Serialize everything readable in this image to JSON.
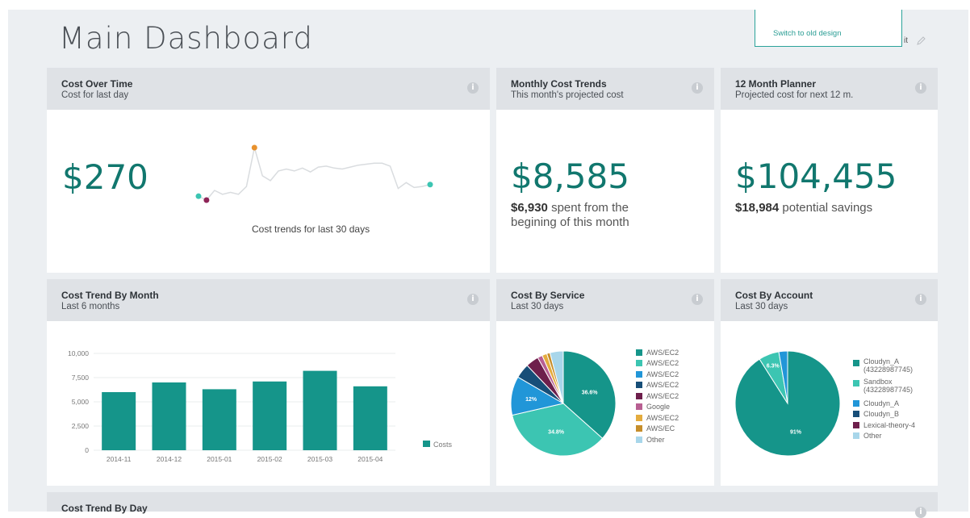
{
  "header": {
    "title": "Main Dashboard",
    "switch_link": "Switch to old design",
    "edit_fragment": "it"
  },
  "cards": {
    "cost_over_time": {
      "title": "Cost Over Time",
      "subtitle": "Cost for last day",
      "value": "$270",
      "caption": "Cost trends for last 30 days",
      "sparkline": [
        24,
        20,
        30,
        26,
        28,
        26,
        34,
        74,
        45,
        40,
        50,
        52,
        50,
        53,
        49,
        54,
        55,
        53,
        52,
        54,
        56,
        57,
        58,
        58,
        55,
        32,
        38,
        33,
        34,
        36
      ]
    },
    "monthly_cost_trends": {
      "title": "Monthly Cost Trends",
      "subtitle": "This month's projected cost",
      "value": "$8,585",
      "detail_amount": "$6,930",
      "detail_text_1": "spent from the",
      "detail_text_2": "begining of this month"
    },
    "planner": {
      "title": "12 Month Planner",
      "subtitle": "Projected cost for next 12 m.",
      "value": "$104,455",
      "detail_amount": "$18,984",
      "detail_text": "potential savings"
    },
    "cost_by_month": {
      "title": "Cost Trend By Month",
      "subtitle": "Last 6 months"
    },
    "cost_by_service": {
      "title": "Cost By Service",
      "subtitle": "Last 30 days",
      "legend": [
        {
          "label": "AWS/EC2",
          "color": "#15958a"
        },
        {
          "label": "AWS/EC2",
          "color": "#3cc5b2"
        },
        {
          "label": "AWS/EC2",
          "color": "#2196d8"
        },
        {
          "label": "AWS/EC2",
          "color": "#174e78"
        },
        {
          "label": "AWS/EC2",
          "color": "#6e1f4c"
        },
        {
          "label": "Google",
          "color": "#b85f92"
        },
        {
          "label": "AWS/EC2",
          "color": "#e4ac3e"
        },
        {
          "label": "AWS/EC",
          "color": "#c68e2b"
        },
        {
          "label": "Other",
          "color": "#a8d6ea"
        }
      ]
    },
    "cost_by_account": {
      "title": "Cost By Account",
      "subtitle": "Last 30 days",
      "legend": [
        {
          "label": "Cloudyn_A",
          "label2": "(43228987745)",
          "color": "#15958a"
        },
        {
          "label": "Sandbox",
          "label2": "(43228987745)",
          "color": "#3cc5b2"
        },
        {
          "label": "Cloudyn_A",
          "label2": "",
          "color": "#2196d8"
        },
        {
          "label": "Cloudyn_B",
          "label2": "",
          "color": "#174e78"
        },
        {
          "label": "Lexical-theory-4",
          "label2": "",
          "color": "#6e1f4c"
        },
        {
          "label": "Other",
          "label2": "",
          "color": "#a8d6ea"
        }
      ]
    },
    "cost_by_day": {
      "title": "Cost Trend By Day"
    }
  },
  "chart_data": [
    {
      "type": "bar",
      "categories": [
        "2014-11",
        "2014-12",
        "2015-01",
        "2015-02",
        "2015-03",
        "2015-04"
      ],
      "series": [
        {
          "name": "Costs",
          "values": [
            6000,
            7000,
            6300,
            7100,
            8200,
            6600
          ],
          "color": "#15958a"
        }
      ],
      "yticks": [
        "0",
        "2,500",
        "5,000",
        "7,500",
        "10,000"
      ],
      "ylim": [
        0,
        10000
      ],
      "legend_position": "right"
    },
    {
      "type": "pie",
      "slices": [
        {
          "value": 36.6,
          "label": "36.6%",
          "color": "#15958a"
        },
        {
          "value": 34.8,
          "label": "34.8%",
          "color": "#3cc5b2"
        },
        {
          "value": 12,
          "label": "12%",
          "color": "#2196d8"
        },
        {
          "value": 4.5,
          "label": "",
          "color": "#174e78"
        },
        {
          "value": 4,
          "label": "",
          "color": "#6e1f4c"
        },
        {
          "value": 1.5,
          "label": "",
          "color": "#b85f92"
        },
        {
          "value": 1.5,
          "label": "",
          "color": "#e4ac3e"
        },
        {
          "value": 1,
          "label": "",
          "color": "#c68e2b"
        },
        {
          "value": 4.1,
          "label": "",
          "color": "#a8d6ea"
        }
      ]
    },
    {
      "type": "pie",
      "slices": [
        {
          "value": 91,
          "label": "91%",
          "color": "#15958a"
        },
        {
          "value": 6.3,
          "label": "6.3%",
          "color": "#3cc5b2"
        },
        {
          "value": 2.7,
          "label": "",
          "color": "#2196d8"
        }
      ]
    }
  ]
}
